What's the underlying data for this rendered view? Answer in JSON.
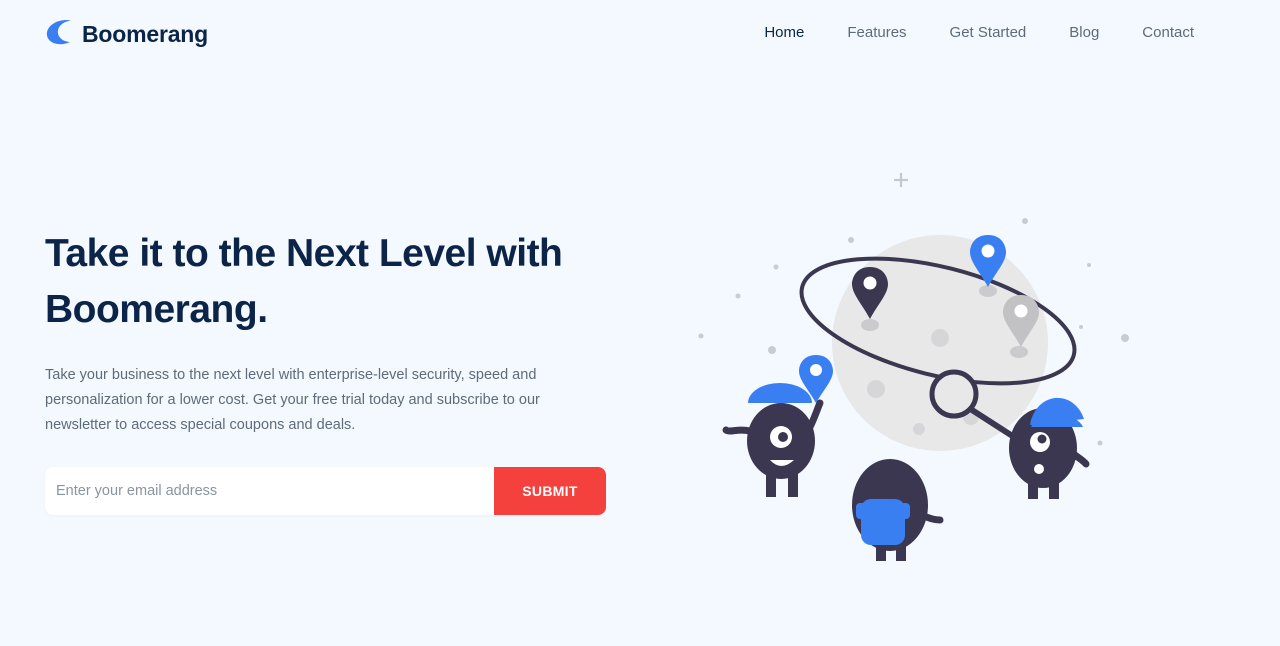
{
  "brand": {
    "name": "Boomerang",
    "logo_icon": "crescent-logo-icon",
    "accent_color": "#3a7ff2",
    "text_color": "#0b2447",
    "cta_color": "#f5413e",
    "background_color": "#f3f9fe"
  },
  "nav": {
    "items": [
      {
        "label": "Home",
        "active": true
      },
      {
        "label": "Features",
        "active": false
      },
      {
        "label": "Get Started",
        "active": false
      },
      {
        "label": "Blog",
        "active": false
      },
      {
        "label": "Contact",
        "active": false
      }
    ]
  },
  "hero": {
    "title_line1": "Take it to the Next Level with",
    "title_line2": "Boomerang.",
    "description": "Take your business to the next level with enterprise-level security, speed and personalization for a lower cost. Get your free trial today and subscribe to our newsletter to access special coupons and deals.",
    "illustration": "monsters-exploring-map-illustration"
  },
  "signup": {
    "email_value": "",
    "email_placeholder": "Enter your email address",
    "submit_label": "SUBMIT"
  }
}
